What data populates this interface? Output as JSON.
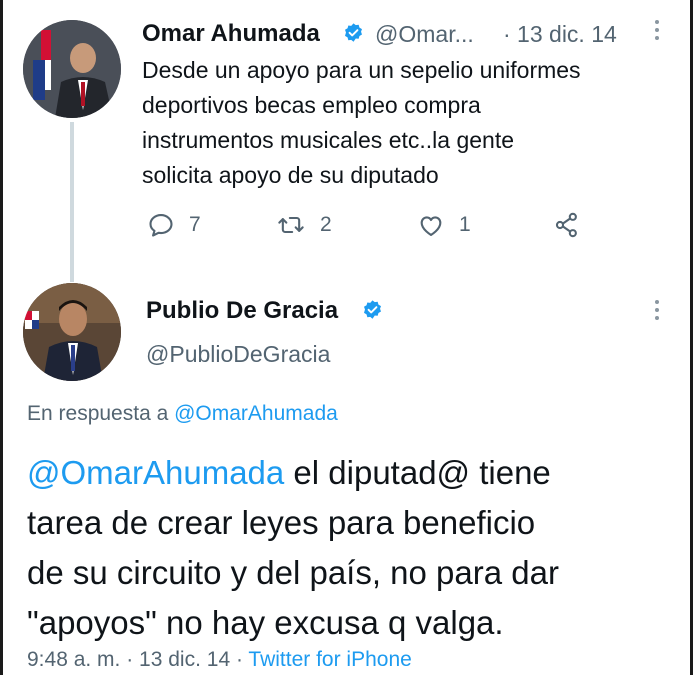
{
  "tweet1": {
    "author_name": "Omar Ahumada",
    "handle": "@Omar...",
    "date": "· 13 dic. 14",
    "text_lines": [
      "Desde un apoyo para un sepelio uniformes",
      "deportivos becas empleo compra",
      "instrumentos musicales etc..la gente",
      "solicita apoyo de su diputado"
    ],
    "replies": "7",
    "retweets": "2",
    "likes": "1"
  },
  "tweet2": {
    "author_name": "Publio De Gracia",
    "handle": "@PublioDeGracia",
    "reply_prefix": "En respuesta a ",
    "reply_to": "@OmarAhumada",
    "mention": "@OmarAhumada",
    "text_lines": [
      " el diputad@ tiene",
      "tarea de crear leyes para beneficio",
      "de su circuito y del país, no para dar",
      "\"apoyos\" no hay excusa q valga."
    ],
    "time": "9:48 a. m.",
    "date": " · 13 dic. 14 · ",
    "source": "Twitter for iPhone"
  },
  "colors": {
    "link": "#1d9bf0",
    "text": "#0f1419",
    "secondary": "#536471",
    "thread_line": "#cfd9de"
  }
}
